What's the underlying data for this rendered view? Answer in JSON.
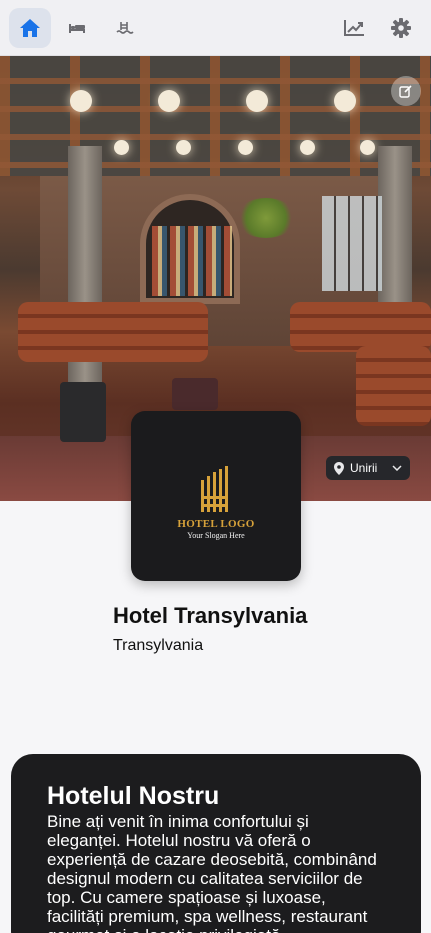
{
  "nav": {
    "items": [
      {
        "icon": "home-icon",
        "active": true
      },
      {
        "icon": "bed-icon",
        "active": false
      },
      {
        "icon": "pool-icon",
        "active": false
      }
    ],
    "right": [
      {
        "icon": "chart-trend-icon"
      },
      {
        "icon": "gear-icon"
      }
    ],
    "accent": "#1a73e8"
  },
  "hero": {
    "edit_icon": "edit-icon"
  },
  "location": {
    "label": "Unirii",
    "icon": "map-pin-icon",
    "chevron": "chevron-down-icon"
  },
  "logo": {
    "title": "HOTEL LOGO",
    "slogan": "Your Slogan Here",
    "gold": "#d7a23a"
  },
  "hotel": {
    "name": "Hotel Transylvania",
    "city": "Transylvania"
  },
  "about": {
    "title": "Hotelul Nostru",
    "text": "Bine ați venit în inima confortului și eleganței. Hotelul nostru vă oferă o experiență de cazare deosebită, combinând designul modern cu calitatea serviciilor de top. Cu camere spațioase și luxoase, facilități premium, spa wellness, restaurant gourmet și o locație privilegiată"
  }
}
